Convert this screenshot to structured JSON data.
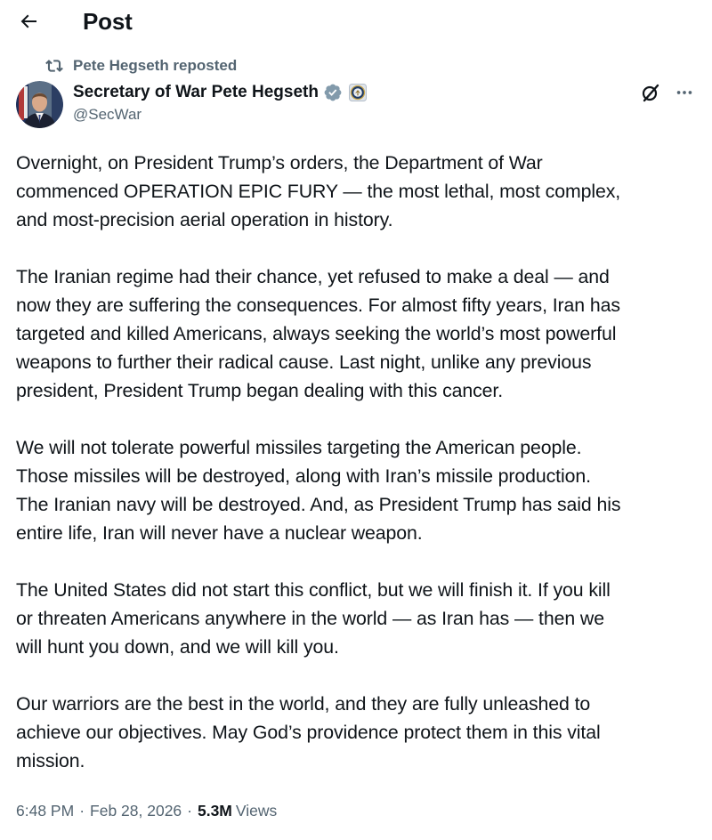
{
  "header": {
    "title": "Post",
    "back_icon": "arrow-left-icon"
  },
  "repost": {
    "icon": "repost-icon",
    "text": "Pete Hegseth reposted"
  },
  "author": {
    "display_name": "Secretary of War Pete Hegseth",
    "handle": "@SecWar",
    "verified_color": "#829aab",
    "affiliate_badge": "department-seal-icon"
  },
  "actions": {
    "grok_icon": "grok-icon",
    "more_icon": "more-horizontal-icon"
  },
  "post": {
    "paragraphs": [
      "Overnight, on President Trump’s orders, the Department of War\ncommenced OPERATION EPIC FURY — the most lethal, most complex,\nand most-precision aerial operation in history.",
      "The Iranian regime had their chance, yet refused to make a deal — and\nnow they are suffering the consequences. For almost fifty years, Iran has\ntargeted and killed Americans, always seeking the world’s most powerful\nweapons to further their radical cause. Last night, unlike any previous\npresident, President Trump began dealing with this cancer.",
      "We will not tolerate powerful missiles targeting the American people.\nThose missiles will be destroyed, along with Iran’s missile production.\nThe Iranian navy will be destroyed. And, as President Trump has said his\nentire life, Iran will never have a nuclear weapon.",
      "The United States did not start this conflict, but we will finish it. If you kill\nor threaten Americans anywhere in the world — as Iran has — then we\nwill hunt you down, and we will kill you.",
      "Our warriors are the best in the world, and they are fully unleashed to\nachieve our objectives. May God’s providence protect them in this vital\nmission."
    ]
  },
  "meta": {
    "time": "6:48 PM",
    "separator": "·",
    "date": "Feb 28, 2026",
    "views_count": "5.3M",
    "views_label": "Views"
  },
  "colors": {
    "text_primary": "#0f1419",
    "text_secondary": "#536471"
  }
}
